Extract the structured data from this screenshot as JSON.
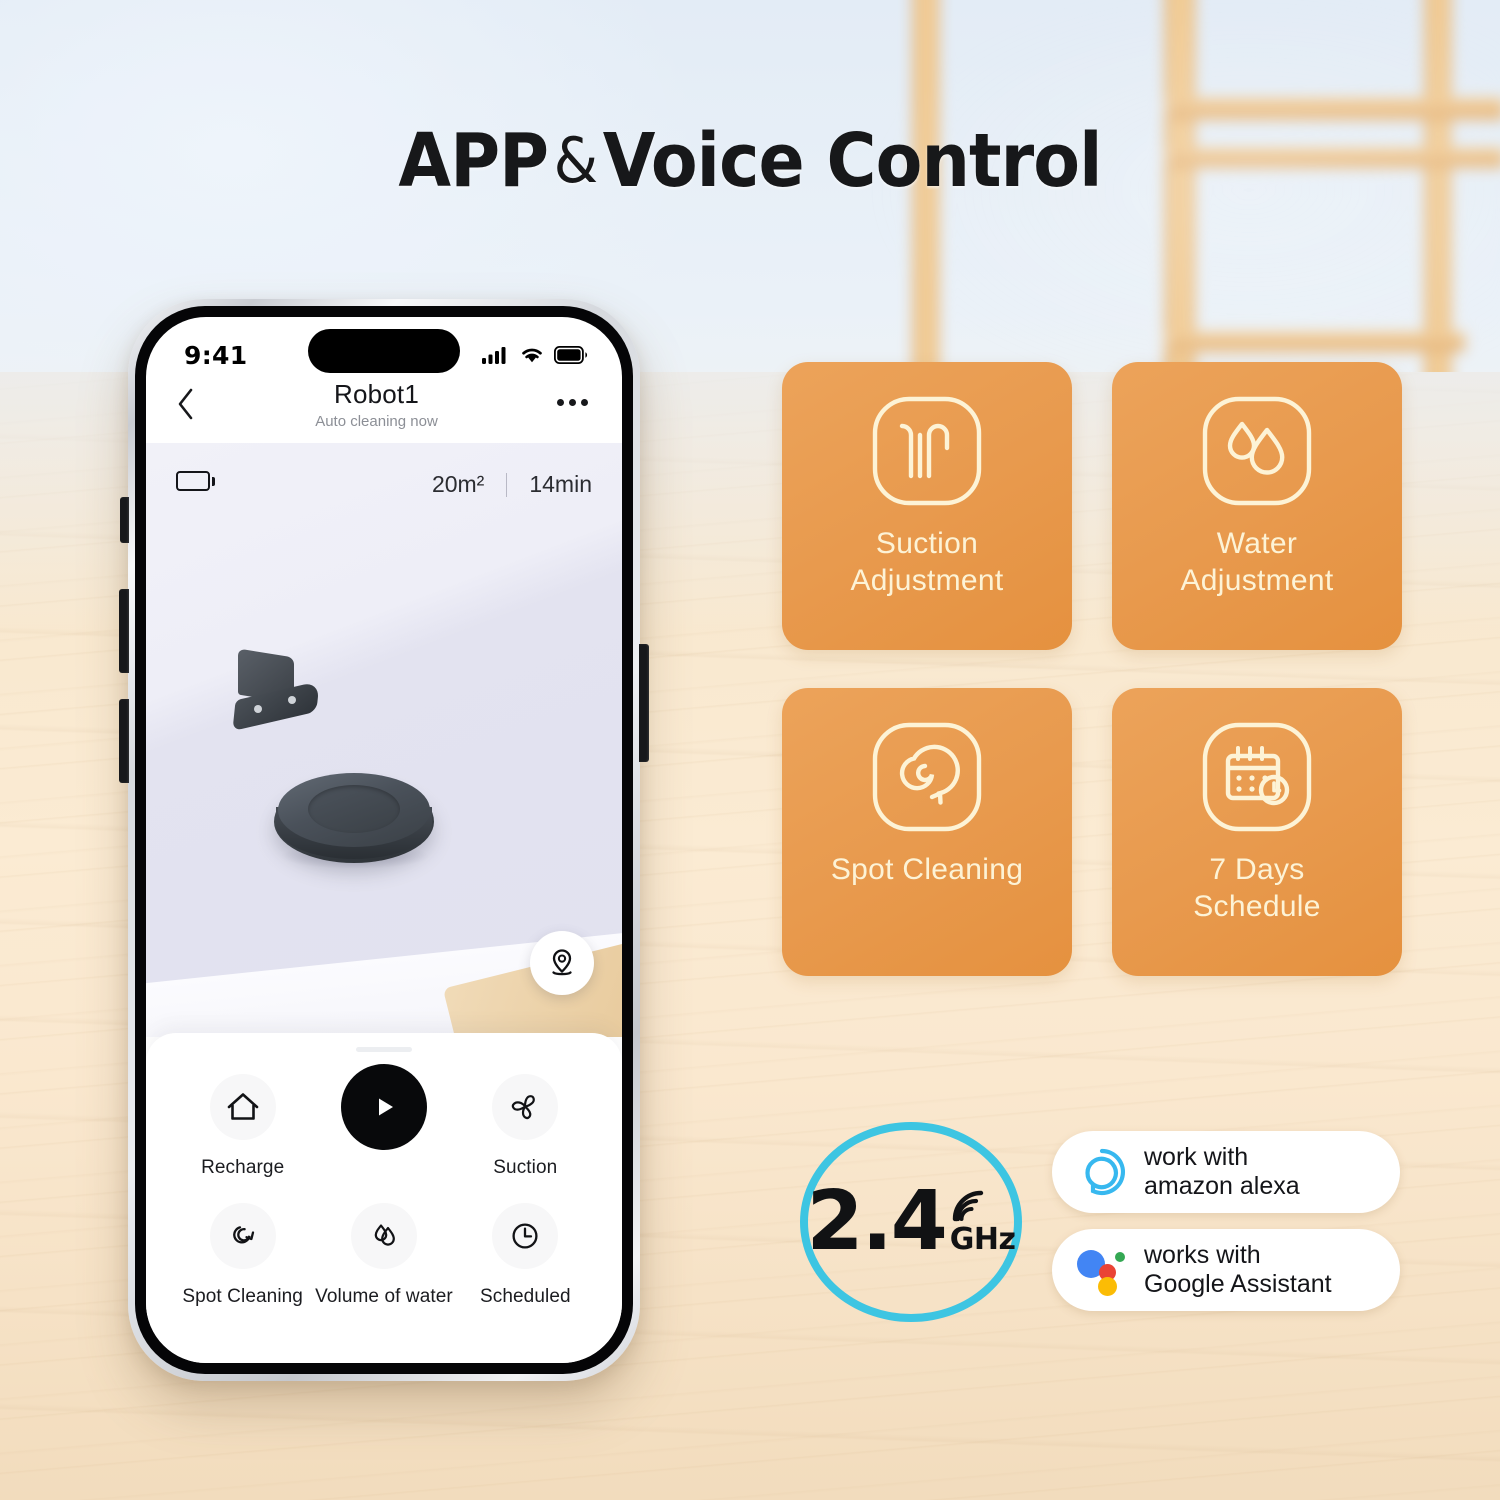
{
  "headline": {
    "part1": "APP",
    "amp": "&",
    "part2": "Voice Control"
  },
  "phone": {
    "status_bar": {
      "time": "9:41",
      "cellular_icon": "signal-bars-icon",
      "wifi_icon": "wifi-icon",
      "battery_icon": "battery-icon"
    },
    "nav": {
      "back_icon": "chevron-left-icon",
      "title": "Robot1",
      "subtitle": "Auto cleaning now",
      "more_icon": "more-options-icon"
    },
    "map": {
      "battery_icon": "battery-level-icon",
      "area": "20m²",
      "duration": "14min",
      "dock_icon": "charging-dock-icon",
      "robot_icon": "robot-vacuum-icon",
      "locate_icon": "location-pin-icon"
    },
    "controls": {
      "row1": [
        {
          "label": "Recharge",
          "icon": "home-icon"
        },
        {
          "label": "",
          "icon": "play-icon"
        },
        {
          "label": "Suction",
          "icon": "fan-icon"
        }
      ],
      "row2": [
        {
          "label": "Spot Cleaning",
          "icon": "spiral-arrow-icon"
        },
        {
          "label": "Volume of water",
          "icon": "water-drops-icon"
        },
        {
          "label": "Scheduled",
          "icon": "clock-icon"
        }
      ]
    }
  },
  "feature_cards": [
    {
      "label": "Suction\nAdjustment",
      "line1": "Suction",
      "line2": "Adjustment",
      "icon": "suction-airflow-icon"
    },
    {
      "label": "Water\nAdjustment",
      "line1": "Water",
      "line2": "Adjustment",
      "icon": "water-drops-icon"
    },
    {
      "label": "Spot Cleaning",
      "line1": "Spot Cleaning",
      "line2": "",
      "icon": "spiral-arrow-icon"
    },
    {
      "label": "7 Days\nSchedule",
      "line1": "7 Days",
      "line2": "Schedule",
      "icon": "calendar-clock-icon"
    }
  ],
  "wifi_badge": {
    "value": "2.4",
    "unit": "GHz",
    "signal_icon": "wifi-arc-icon"
  },
  "assistants": [
    {
      "line1": "work with",
      "line2": "amazon alexa",
      "logo": "amazon-alexa-logo"
    },
    {
      "line1": "works with",
      "line2": "Google Assistant",
      "logo": "google-assistant-logo"
    }
  ],
  "colors": {
    "card_orange": "#e89a4e",
    "card_text": "#fdf3d6",
    "wifi_ring": "#3dc5e2",
    "alexa_blue": "#37b8ef",
    "battery_green": "#5fd440",
    "google_blue": "#4285f4",
    "google_red": "#ea4335",
    "google_yellow": "#fbbc05",
    "google_green": "#34a853"
  }
}
